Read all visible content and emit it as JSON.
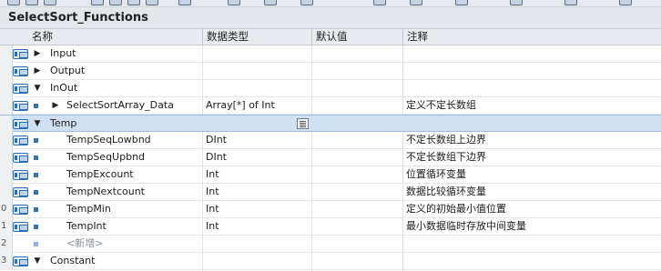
{
  "window": {
    "title": "SelectSort_Functions"
  },
  "columns": {
    "name": "名称",
    "datatype": "数据类型",
    "default": "默认值",
    "comment": "注释"
  },
  "rows": [
    {
      "num": "",
      "name": "Input",
      "type": "",
      "comment": "",
      "kind": "section",
      "expand": "collapsed"
    },
    {
      "num": "",
      "name": "Output",
      "type": "",
      "comment": "",
      "kind": "section",
      "expand": "collapsed"
    },
    {
      "num": "",
      "name": "InOut",
      "type": "",
      "comment": "",
      "kind": "section",
      "expand": "expanded"
    },
    {
      "num": "",
      "name": "SelectSortArray_Data",
      "type": "Array[*] of Int",
      "comment": "定义不定长数组",
      "kind": "member-arrow"
    },
    {
      "num": "",
      "name": "Temp",
      "type": "",
      "comment": "",
      "kind": "section",
      "expand": "expanded",
      "selected": true
    },
    {
      "num": "",
      "name": "TempSeqLowbnd",
      "type": "DInt",
      "comment": "不定长数组上边界",
      "kind": "member"
    },
    {
      "num": "",
      "name": "TempSeqUpbnd",
      "type": "DInt",
      "comment": "不定长数组下边界",
      "kind": "member"
    },
    {
      "num": "",
      "name": "TempExcount",
      "type": "Int",
      "comment": "位置循环变量",
      "kind": "member"
    },
    {
      "num": "",
      "name": "TempNextcount",
      "type": "Int",
      "comment": "数据比较循环变量",
      "kind": "member"
    },
    {
      "num": "0",
      "name": "TempMin",
      "type": "Int",
      "comment": "定义的初始最小值位置",
      "kind": "member"
    },
    {
      "num": "1",
      "name": "TempInt",
      "type": "Int",
      "comment": "最小数据临时存放中间变量",
      "kind": "member"
    },
    {
      "num": "2",
      "name": "<新增>",
      "type": "",
      "comment": "",
      "kind": "add"
    },
    {
      "num": "3",
      "name": "Constant",
      "type": "",
      "comment": "",
      "kind": "section",
      "expand": "expanded"
    }
  ],
  "icons": {
    "expand_collapsed": "▶",
    "expand_expanded": "▼",
    "io": "interface-icon",
    "member": "member-square-icon"
  },
  "colors": {
    "accent": "#2d6db5",
    "selected_row": "#cfe0f3"
  }
}
